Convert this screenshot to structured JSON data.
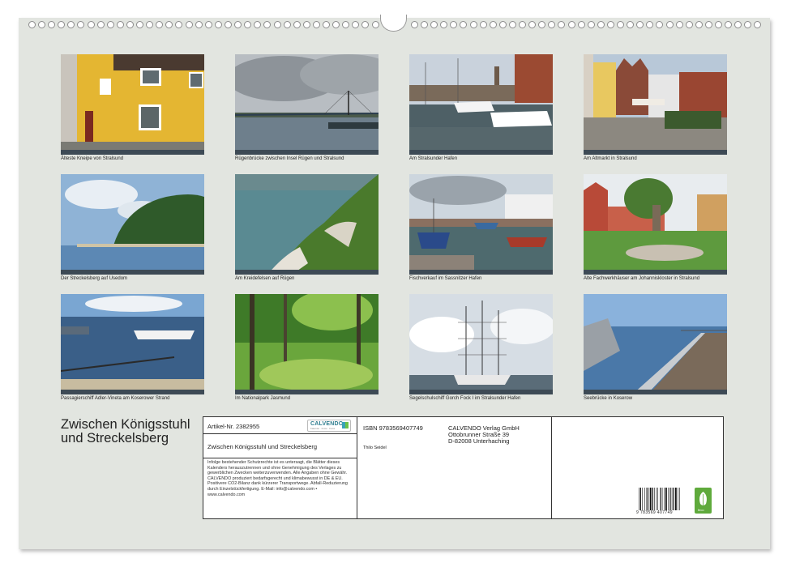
{
  "calendar": {
    "title_line1": "Zwischen Königsstuhl",
    "title_line2": "und Streckelsberg",
    "photos": [
      {
        "caption": "Älteste Kneipe von Stralsund",
        "scene": "yellow-house"
      },
      {
        "caption": "Rügenbrücke zwischen Insel Rügen und Stralsund",
        "scene": "bridge"
      },
      {
        "caption": "Am Stralsunder Hafen",
        "scene": "harbor"
      },
      {
        "caption": "Am Altmarkt in Stralsund",
        "scene": "old-market"
      },
      {
        "caption": "Der Streckelsberg auf Usedom",
        "scene": "cliff-sea"
      },
      {
        "caption": "Am Kreidefelsen auf Rügen",
        "scene": "chalk-cliff"
      },
      {
        "caption": "Fischverkauf im Sassnitzer Hafen",
        "scene": "fish-harbor"
      },
      {
        "caption": "Alte Fachwerkhäuser am Johanniskloster in Stralsund",
        "scene": "half-timbered"
      },
      {
        "caption": "Passagierschiff Adler-Vineta am Koserower Strand",
        "scene": "passenger-ship"
      },
      {
        "caption": "Im Nationalpark Jasmund",
        "scene": "forest"
      },
      {
        "caption": "Segelschulschiff Gorch Fock I im Stralsunder Hafen",
        "scene": "tall-ship"
      },
      {
        "caption": "Seebrücke in Koserow",
        "scene": "pier"
      }
    ]
  },
  "info": {
    "article_label": "Artikel-Nr. 2382955",
    "logo_text": "CALVENDO",
    "logo_sub": "Kalender · Fotos · Kunst",
    "product_title": "Zwischen Königsstuhl und Streckelsberg",
    "legal_text": "Infolge bestehender Schutzrechte ist es untersagt, die Blätter dieses Kalenders herauszutrennen und ohne Genehmigung des Verlages zu gewerblichen Zwecken weiterzuverwenden. Alle Angaben ohne Gewähr. CALVENDO produziert bedarfsgerecht und klimabewusst in DE & EU. Positivere CO2-Bilanz dank kürzerer Transportwege. Abfall-Reduzierung durch Einzelstückfertigung. E-Mail: info@calvendo.com • www.calvendo.com",
    "isbn": "ISBN 9783569407749",
    "author": "Thilo Seidel",
    "publisher_name": "CALVENDO Verlag GmbH",
    "publisher_street": "Ottobrunner Straße 39",
    "publisher_city": "D-82008 Unterhaching",
    "ean_digits": "9 783569 407749",
    "feco_label": "feco"
  }
}
